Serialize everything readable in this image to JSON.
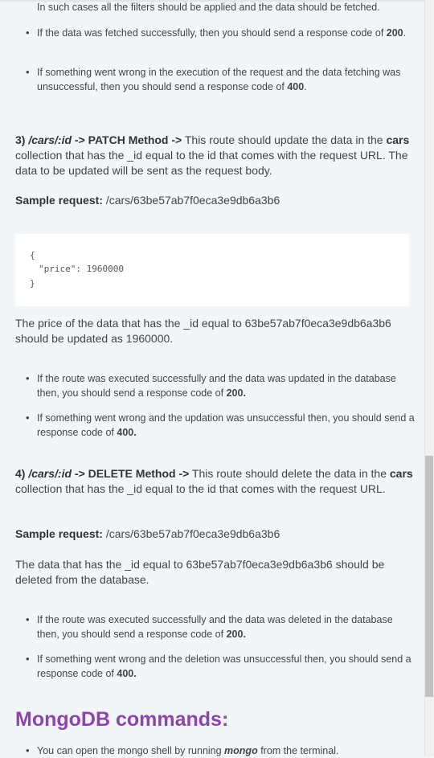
{
  "bullets_top": [
    "In such cases all the filters should be applied and the data should be fetched.",
    "If the data was fetched successfully, then you should send a response code of |200|.",
    "If something went wrong in the execution of the request and the data fetching was unsuccessful, then you should send a response code of |400|."
  ],
  "patch": {
    "num": "3) ",
    "route": "/cars/:id",
    "arrow1": " -> ",
    "method": "PATCH Method",
    "arrow2": " ->",
    "desc1": " This route should update the data in the ",
    "collection": "cars",
    "desc2": " collection that has the _id equal to the id that comes with the request URL. The data to be updated will be sent as the request body.",
    "sample_label": "Sample request:",
    "sample_value": " /cars/63be57ab7f0eca3e9db6a3b6",
    "code_open": "{",
    "code_key": "\"price\"",
    "code_sep": ": ",
    "code_val": "1960000",
    "code_close": "}",
    "result": "The price of the data that has the _id equal to 63be57ab7f0eca3e9db6a3b6 should be updated as 1960000.",
    "bullet1": "If the route was executed successfully and the data was updated in the database then, you should send a response code of ",
    "code1": "200.",
    "bullet2": "If something went wrong and the updation was unsuccessful then, you should send a response code of ",
    "code2": "400."
  },
  "del": {
    "num": "4) ",
    "route": "/cars/:id",
    "arrow1": " -> ",
    "method": "DELETE Method",
    "arrow2": " ->",
    "desc1": " This route should delete the data in the ",
    "collection": "cars",
    "desc2": " collection that has the _id equal to the id that comes with the request URL.",
    "sample_label": "Sample request:",
    "sample_value": " /cars/63be57ab7f0eca3e9db6a3b6",
    "result": "The data that has the _id equal to 63be57ab7f0eca3e9db6a3b6 should be deleted from the database.",
    "bullet1": "If the route was executed successfully and the data was deleted in the database then, you should send a response code of ",
    "code1": "200.",
    "bullet2": "If something went wrong and the deletion was unsuccessful then, you should send a response code of ",
    "code2": "400."
  },
  "mongo": {
    "heading": "MongoDB commands:",
    "bullet_pre": "You can open the mongo shell by running ",
    "bullet_cmd": "mongo",
    "bullet_post": " from the terminal."
  }
}
